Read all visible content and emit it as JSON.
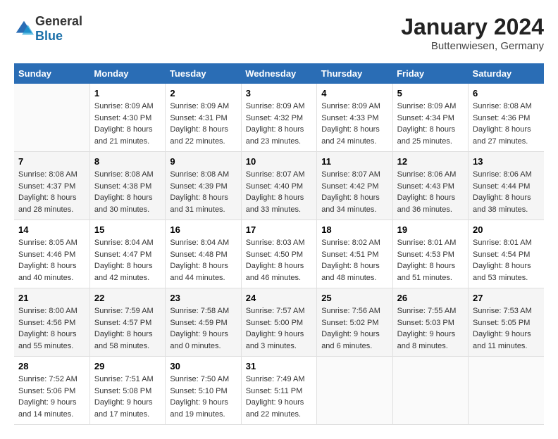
{
  "logo": {
    "general": "General",
    "blue": "Blue"
  },
  "header": {
    "month": "January 2024",
    "location": "Buttenwiesen, Germany"
  },
  "weekdays": [
    "Sunday",
    "Monday",
    "Tuesday",
    "Wednesday",
    "Thursday",
    "Friday",
    "Saturday"
  ],
  "weeks": [
    [
      {
        "day": "",
        "sunrise": "",
        "sunset": "",
        "daylight": ""
      },
      {
        "day": "1",
        "sunrise": "Sunrise: 8:09 AM",
        "sunset": "Sunset: 4:30 PM",
        "daylight": "Daylight: 8 hours and 21 minutes."
      },
      {
        "day": "2",
        "sunrise": "Sunrise: 8:09 AM",
        "sunset": "Sunset: 4:31 PM",
        "daylight": "Daylight: 8 hours and 22 minutes."
      },
      {
        "day": "3",
        "sunrise": "Sunrise: 8:09 AM",
        "sunset": "Sunset: 4:32 PM",
        "daylight": "Daylight: 8 hours and 23 minutes."
      },
      {
        "day": "4",
        "sunrise": "Sunrise: 8:09 AM",
        "sunset": "Sunset: 4:33 PM",
        "daylight": "Daylight: 8 hours and 24 minutes."
      },
      {
        "day": "5",
        "sunrise": "Sunrise: 8:09 AM",
        "sunset": "Sunset: 4:34 PM",
        "daylight": "Daylight: 8 hours and 25 minutes."
      },
      {
        "day": "6",
        "sunrise": "Sunrise: 8:08 AM",
        "sunset": "Sunset: 4:36 PM",
        "daylight": "Daylight: 8 hours and 27 minutes."
      }
    ],
    [
      {
        "day": "7",
        "sunrise": "Sunrise: 8:08 AM",
        "sunset": "Sunset: 4:37 PM",
        "daylight": "Daylight: 8 hours and 28 minutes."
      },
      {
        "day": "8",
        "sunrise": "Sunrise: 8:08 AM",
        "sunset": "Sunset: 4:38 PM",
        "daylight": "Daylight: 8 hours and 30 minutes."
      },
      {
        "day": "9",
        "sunrise": "Sunrise: 8:08 AM",
        "sunset": "Sunset: 4:39 PM",
        "daylight": "Daylight: 8 hours and 31 minutes."
      },
      {
        "day": "10",
        "sunrise": "Sunrise: 8:07 AM",
        "sunset": "Sunset: 4:40 PM",
        "daylight": "Daylight: 8 hours and 33 minutes."
      },
      {
        "day": "11",
        "sunrise": "Sunrise: 8:07 AM",
        "sunset": "Sunset: 4:42 PM",
        "daylight": "Daylight: 8 hours and 34 minutes."
      },
      {
        "day": "12",
        "sunrise": "Sunrise: 8:06 AM",
        "sunset": "Sunset: 4:43 PM",
        "daylight": "Daylight: 8 hours and 36 minutes."
      },
      {
        "day": "13",
        "sunrise": "Sunrise: 8:06 AM",
        "sunset": "Sunset: 4:44 PM",
        "daylight": "Daylight: 8 hours and 38 minutes."
      }
    ],
    [
      {
        "day": "14",
        "sunrise": "Sunrise: 8:05 AM",
        "sunset": "Sunset: 4:46 PM",
        "daylight": "Daylight: 8 hours and 40 minutes."
      },
      {
        "day": "15",
        "sunrise": "Sunrise: 8:04 AM",
        "sunset": "Sunset: 4:47 PM",
        "daylight": "Daylight: 8 hours and 42 minutes."
      },
      {
        "day": "16",
        "sunrise": "Sunrise: 8:04 AM",
        "sunset": "Sunset: 4:48 PM",
        "daylight": "Daylight: 8 hours and 44 minutes."
      },
      {
        "day": "17",
        "sunrise": "Sunrise: 8:03 AM",
        "sunset": "Sunset: 4:50 PM",
        "daylight": "Daylight: 8 hours and 46 minutes."
      },
      {
        "day": "18",
        "sunrise": "Sunrise: 8:02 AM",
        "sunset": "Sunset: 4:51 PM",
        "daylight": "Daylight: 8 hours and 48 minutes."
      },
      {
        "day": "19",
        "sunrise": "Sunrise: 8:01 AM",
        "sunset": "Sunset: 4:53 PM",
        "daylight": "Daylight: 8 hours and 51 minutes."
      },
      {
        "day": "20",
        "sunrise": "Sunrise: 8:01 AM",
        "sunset": "Sunset: 4:54 PM",
        "daylight": "Daylight: 8 hours and 53 minutes."
      }
    ],
    [
      {
        "day": "21",
        "sunrise": "Sunrise: 8:00 AM",
        "sunset": "Sunset: 4:56 PM",
        "daylight": "Daylight: 8 hours and 55 minutes."
      },
      {
        "day": "22",
        "sunrise": "Sunrise: 7:59 AM",
        "sunset": "Sunset: 4:57 PM",
        "daylight": "Daylight: 8 hours and 58 minutes."
      },
      {
        "day": "23",
        "sunrise": "Sunrise: 7:58 AM",
        "sunset": "Sunset: 4:59 PM",
        "daylight": "Daylight: 9 hours and 0 minutes."
      },
      {
        "day": "24",
        "sunrise": "Sunrise: 7:57 AM",
        "sunset": "Sunset: 5:00 PM",
        "daylight": "Daylight: 9 hours and 3 minutes."
      },
      {
        "day": "25",
        "sunrise": "Sunrise: 7:56 AM",
        "sunset": "Sunset: 5:02 PM",
        "daylight": "Daylight: 9 hours and 6 minutes."
      },
      {
        "day": "26",
        "sunrise": "Sunrise: 7:55 AM",
        "sunset": "Sunset: 5:03 PM",
        "daylight": "Daylight: 9 hours and 8 minutes."
      },
      {
        "day": "27",
        "sunrise": "Sunrise: 7:53 AM",
        "sunset": "Sunset: 5:05 PM",
        "daylight": "Daylight: 9 hours and 11 minutes."
      }
    ],
    [
      {
        "day": "28",
        "sunrise": "Sunrise: 7:52 AM",
        "sunset": "Sunset: 5:06 PM",
        "daylight": "Daylight: 9 hours and 14 minutes."
      },
      {
        "day": "29",
        "sunrise": "Sunrise: 7:51 AM",
        "sunset": "Sunset: 5:08 PM",
        "daylight": "Daylight: 9 hours and 17 minutes."
      },
      {
        "day": "30",
        "sunrise": "Sunrise: 7:50 AM",
        "sunset": "Sunset: 5:10 PM",
        "daylight": "Daylight: 9 hours and 19 minutes."
      },
      {
        "day": "31",
        "sunrise": "Sunrise: 7:49 AM",
        "sunset": "Sunset: 5:11 PM",
        "daylight": "Daylight: 9 hours and 22 minutes."
      },
      {
        "day": "",
        "sunrise": "",
        "sunset": "",
        "daylight": ""
      },
      {
        "day": "",
        "sunrise": "",
        "sunset": "",
        "daylight": ""
      },
      {
        "day": "",
        "sunrise": "",
        "sunset": "",
        "daylight": ""
      }
    ]
  ]
}
